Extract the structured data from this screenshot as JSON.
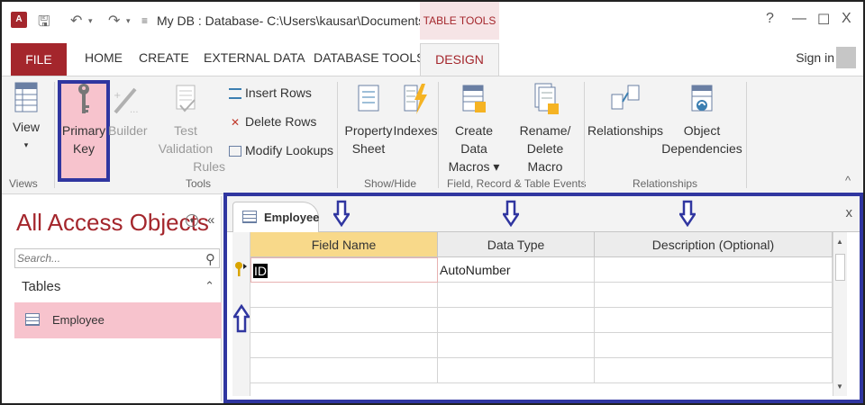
{
  "titlebar": {
    "title": "My DB : Database- C:\\Users\\kausar\\Documents\\...",
    "context_tab": "TABLE TOOLS",
    "help": "?",
    "minimize": "—",
    "maximize": "☐",
    "close": "X"
  },
  "tabs": {
    "file": "FILE",
    "home": "HOME",
    "create": "CREATE",
    "external_data": "EXTERNAL DATA",
    "database_tools": "DATABASE TOOLS",
    "design": "DESIGN",
    "sign_in": "Sign in"
  },
  "ribbon": {
    "view": {
      "label": "View",
      "arrow": "▾"
    },
    "primary_key": {
      "label1": "Primary",
      "label2": "Key"
    },
    "builder": {
      "label": "Builder"
    },
    "test_validation": {
      "label1": "Test Validation",
      "label2": "Rules"
    },
    "insert_rows": "Insert Rows",
    "delete_rows": "Delete Rows",
    "modify_lookups": "Modify Lookups",
    "property_sheet": {
      "label1": "Property",
      "label2": "Sheet"
    },
    "indexes": "Indexes",
    "create_data_macros": {
      "label1": "Create Data",
      "label2": "Macros ▾"
    },
    "rename_delete_macro": {
      "label1": "Rename/",
      "label2": "Delete Macro"
    },
    "relationships": "Relationships",
    "object_dependencies": {
      "label1": "Object",
      "label2": "Dependencies"
    },
    "groups": {
      "views": "Views",
      "tools": "Tools",
      "show_hide": "Show/Hide",
      "field_record_events": "Field, Record & Table Events",
      "relationships": "Relationships"
    },
    "collapse": "^"
  },
  "nav": {
    "title": "All Access Objects",
    "dropdown": "▾",
    "collapse": "«",
    "search_placeholder": "Search...",
    "search_icon": "⚲",
    "section": "Tables",
    "section_chevron": "⌃",
    "items": [
      {
        "label": "Employee"
      }
    ]
  },
  "document": {
    "tab_label": "Employee",
    "close": "x",
    "columns": [
      "Field Name",
      "Data Type",
      "Description (Optional)"
    ],
    "rows": [
      {
        "field_name": "ID",
        "data_type": "AutoNumber",
        "description": "",
        "primary_key": true
      }
    ]
  },
  "colors": {
    "access_red": "#a4262c",
    "highlight_blue": "#3036a0",
    "selected_pink": "#f7c3cd",
    "active_header": "#f8d98a"
  }
}
